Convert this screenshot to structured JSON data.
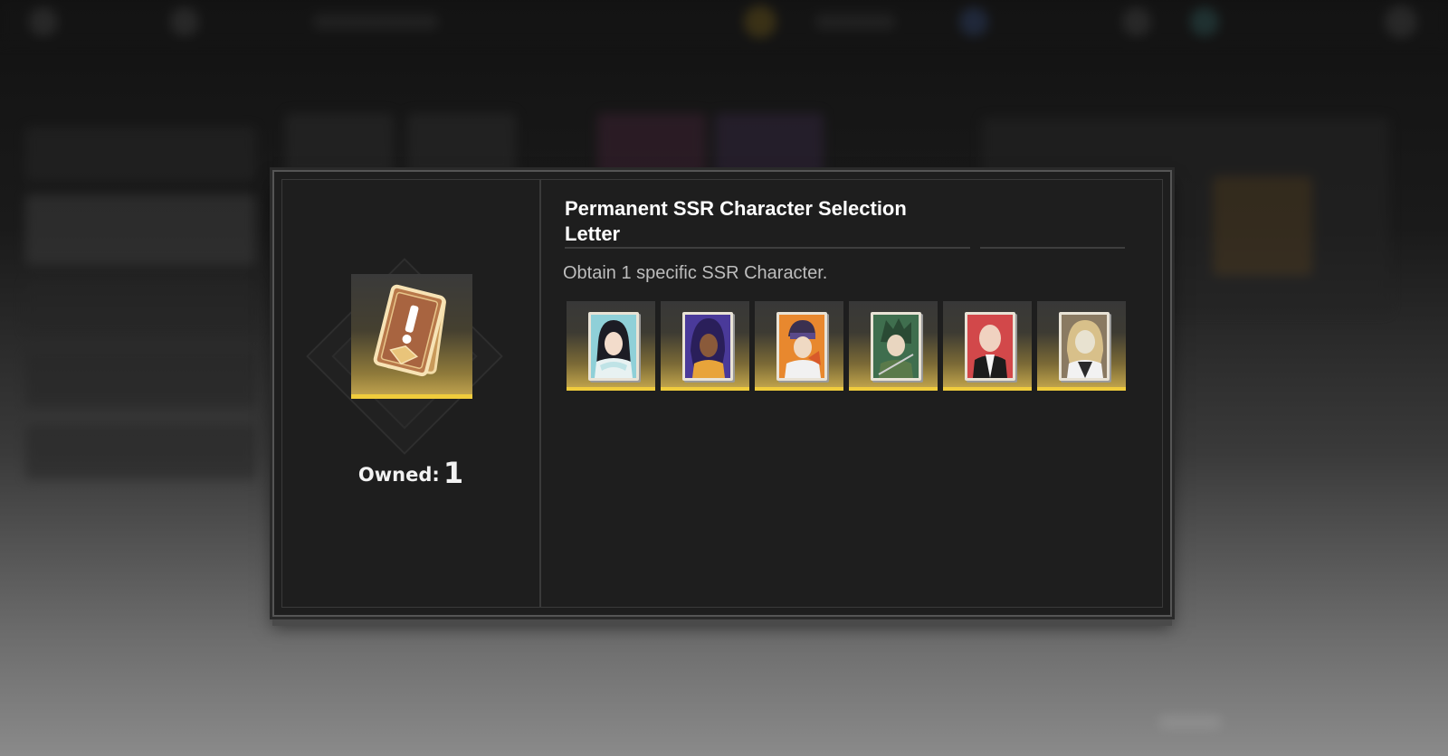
{
  "dialog": {
    "title": "Permanent SSR Character Selection Letter",
    "description": "Obtain 1 specific SSR Character.",
    "owned_label": "Owned:",
    "owned_count": "1"
  },
  "item": {
    "icon": "selection-letter-icon",
    "rarity_color": "#f0cc3c"
  },
  "characters": [
    {
      "icon": "character-portrait-black-hair-scarf",
      "bg": "#8fd0d8"
    },
    {
      "icon": "character-portrait-purple-hair",
      "bg": "#4a3a9a"
    },
    {
      "icon": "character-portrait-visor-orange",
      "bg": "#e8882e"
    },
    {
      "icon": "character-portrait-green-hair",
      "bg": "#3f6e4e"
    },
    {
      "icon": "character-portrait-bald",
      "bg": "#d2484a"
    },
    {
      "icon": "character-portrait-masked-blond",
      "bg": "#8a7a62"
    }
  ]
}
